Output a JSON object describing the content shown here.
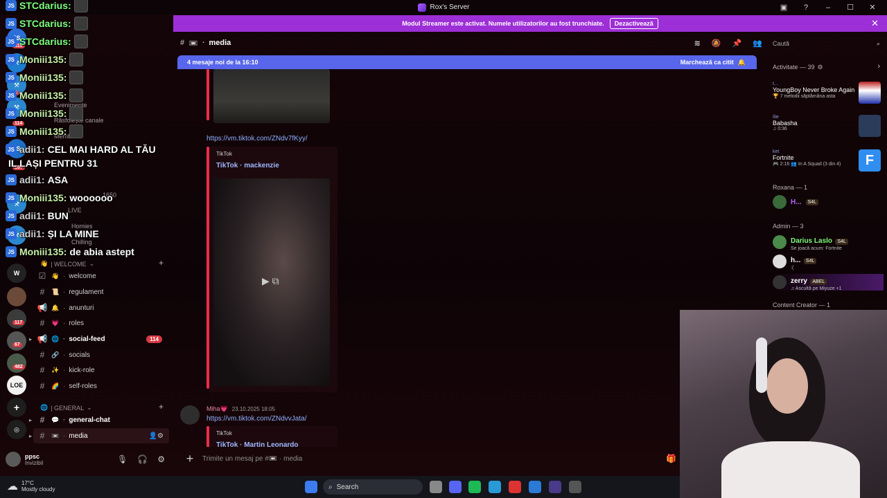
{
  "window": {
    "title": "Rox's Server"
  },
  "banner": {
    "text": "Modul Streamer este activat. Numele utilizatorilor au fost trunchiate.",
    "button": "Dezactivează",
    "close": "✕"
  },
  "rail": {
    "badges": [
      "319",
      "6",
      "114",
      "107",
      "117",
      "67",
      "482"
    ]
  },
  "overlay": {
    "lines": [
      {
        "name": "STCdarius:",
        "msg": "",
        "color": "#7dff7d"
      },
      {
        "name": "STCdarius:",
        "msg": "",
        "color": "#7dff7d"
      },
      {
        "name": "STCdarius:",
        "msg": "",
        "color": "#7dff7d"
      },
      {
        "name": "Moniii135:",
        "msg": "",
        "color": "#c8f0a8"
      },
      {
        "name": "Moniii135:",
        "msg": "",
        "color": "#c8f0a8"
      },
      {
        "name": "Moniii135:",
        "msg": "",
        "color": "#c8f0a8"
      },
      {
        "name": "Moniii135:",
        "msg": "",
        "color": "#c8f0a8"
      },
      {
        "name": "Moniii135:",
        "msg": "",
        "color": "#c8f0a8"
      },
      {
        "name": "adii1:",
        "msg": "CEL MAI HARD AL TĂU",
        "color": "#cfcfcf"
      },
      {
        "name": "",
        "msg": "IL LAȘI PENTRU 31",
        "color": "#ffffff"
      },
      {
        "name": "adii1:",
        "msg": "ASA",
        "color": "#cfcfcf"
      },
      {
        "name": "Moniii135:",
        "msg": "woooooo",
        "color": "#c8f0a8"
      },
      {
        "name": "adii1:",
        "msg": "BUN",
        "color": "#cfcfcf"
      },
      {
        "name": "adii1:",
        "msg": "ȘI LA MINE",
        "color": "#cfcfcf"
      },
      {
        "name": "Moniii135:",
        "msg": "de abia astept",
        "color": "#c8f0a8"
      }
    ],
    "ghost": {
      "evenimente": "Evenimente",
      "rasfoieste": "Răsfoiește canale",
      "membri": "Membri",
      "live": "LIVE",
      "homies": "Homies",
      "chilling": "Chilling",
      "count": "1650"
    }
  },
  "sidebar": {
    "welcome_category": "| WELCOME",
    "welcome_channels": [
      {
        "emoji": "👋",
        "label": "welcome"
      },
      {
        "emoji": "📜",
        "label": "regulament"
      },
      {
        "emoji": "🔔",
        "label": "anunturi"
      },
      {
        "emoji": "💗",
        "label": "roles"
      },
      {
        "emoji": "🌐",
        "label": "social-feed",
        "badge": "114"
      },
      {
        "emoji": "🔗",
        "label": "socials"
      },
      {
        "emoji": "✨",
        "label": "kick-role"
      },
      {
        "emoji": "🌈",
        "label": "self-roles"
      }
    ],
    "general_category": "| GENERAL",
    "general_channels": [
      {
        "emoji": "💬",
        "label": "general-chat"
      },
      {
        "emoji": "📼",
        "label": "media"
      }
    ]
  },
  "header": {
    "channel": "media",
    "emoji": "📼"
  },
  "newmsg": {
    "text": "4 mesaje noi de la 16:10",
    "mark": "Marchează ca citit"
  },
  "chat": {
    "link1": "https://vm.tiktok.com/ZNdv7fKyy/",
    "provider1": "TikTok",
    "author1": "TikTok · mackenzie",
    "msg2_user": "Miha💗",
    "msg2_time": "23.10.2025 18:05",
    "link2": "https://vm.tiktok.com/ZNdvvJata/",
    "provider2": "TikTok",
    "author2": "TikTok · Martin Leonardo"
  },
  "composer": {
    "placeholder": "Trimite un mesaj pe #📼 · media"
  },
  "user": {
    "name": "ppsc",
    "status": "Invizibil"
  },
  "members": {
    "search": "Caută",
    "activity_head": "Activitate — 39",
    "activities": [
      {
        "who": "t...",
        "title": "YoungBoy Never Broke Again",
        "sub": "🏆 7 melodii săptămâna asta"
      },
      {
        "who": "Ilie",
        "title": "Babasha",
        "sub": "♫ 0:36"
      },
      {
        "who": "ket",
        "title": "Fortnite",
        "sub": "🎮 2:16  👥 In A Squad (3 din 4)"
      }
    ],
    "roxana_head": "Roxana — 1",
    "roxana_member": {
      "name": "H...",
      "tag": "S4L"
    },
    "admin_head": "Admin — 3",
    "admins": [
      {
        "name": "Darius Laslo",
        "tag": "S4L",
        "sub": "Se joacă acum: Fortnite",
        "color": "#7dff7d"
      },
      {
        "name": "h...",
        "tag": "S4L",
        "sub": ":(",
        "color": "#ffffff"
      },
      {
        "name": "zerry",
        "tag": "ABEL",
        "sub": "♫ Ascultă pe Miyuze +1",
        "color": "#ffffff"
      }
    ],
    "creator_head": "Content Creator — 1"
  },
  "taskbar": {
    "temp": "17°C",
    "weather": "Mostly cloudy",
    "search": "Search"
  }
}
